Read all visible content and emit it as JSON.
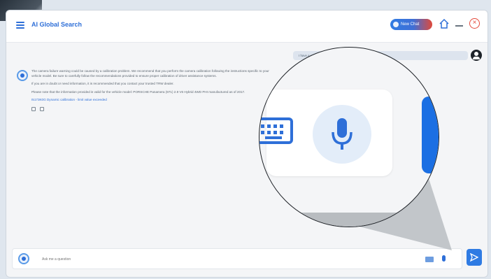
{
  "header": {
    "title": "AI Global Search",
    "new_chat_label": "New Chat"
  },
  "conversation": {
    "user_message": "I have a question about camera failure warning on the display",
    "bot_paragraph_1": "The camera failure warning could be caused by a calibration problem. We recommend that you perform the camera calibration following the instructions specific to your vehicle model. Be sure to carefully follow the recommendations provided to ensure proper calibration of driver assistance systems.",
    "bot_paragraph_2": "If you are in doubt or need information, it is recommended that you contact your trusted TRW dealer.",
    "bot_paragraph_3": "Please note that the information provided is valid for the vehicle model: PORSCHE Panamera (971) 2.9 V6 Hybrid 4WD PHI manufactured as of 2017.",
    "bot_link": "I5173K0G Dynamic calibration - limit value exceeded"
  },
  "input": {
    "placeholder": "Ask me a question"
  },
  "colors": {
    "accent": "#2e6fd8",
    "close": "#e44a3c",
    "magnifier_blue": "#1b6fe3"
  },
  "icons": {
    "menu": "hamburger-icon",
    "home": "home-icon",
    "minimize": "minimize-icon",
    "close": "close-circle-icon",
    "keyboard": "keyboard-icon",
    "mic": "microphone-icon",
    "send": "send-icon"
  }
}
